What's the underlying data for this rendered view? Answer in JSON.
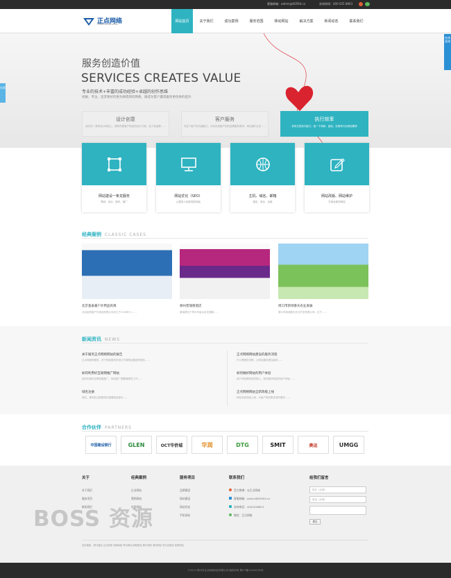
{
  "topbar": {
    "email": "客服邮箱：admin@00594.cn",
    "phone": "咨询热线：400 025 8803"
  },
  "logo": {
    "name": "正点网络",
    "sub": "ZHENGDIAN NETWORK"
  },
  "nav": [
    "网站首页",
    "关于我们",
    "成功案例",
    "服务范围",
    "移动网站",
    "解决方案",
    "新闻动态",
    "联系我们"
  ],
  "hero": {
    "title_cn": "服务创造价值",
    "title_en": "SERVICES CREATES VALUE",
    "sub": "专业的技术+丰富的成功经验+卓越的创作思维",
    "desc": "机敏、专注，追求更好的更为顾得到的网络，随成为客户赢得服务更优秀的提升",
    "tabs": [
      {
        "title": "设计创意",
        "desc": "我们在一类的设计网站上，拥有的是客户网站的设计方案，定义到品牌……"
      },
      {
        "title": "客户服务",
        "desc": "丰富了客户的沟通能力，分析实现客户的的品牌服务需求，网站通行业多……"
      },
      {
        "title": "执行效率",
        "desc": "来传达的执行能力，统一下来和，高效，实现有行业网站需求"
      }
    ]
  },
  "services": [
    {
      "icon": "crop-icon",
      "title": "网站建设一条龙服务",
      "desc": "策划、设计、制作、推广"
    },
    {
      "icon": "monitor-icon",
      "title": "网站优化（SEO）",
      "desc": "让更多人找到您的网站"
    },
    {
      "icon": "basketball-icon",
      "title": "主机、域名、邮箱",
      "desc": "稳定、低价、全能"
    },
    {
      "icon": "edit-icon",
      "title": "网站改版、网站维护",
      "desc": "打造全新的网站"
    }
  ],
  "cases": {
    "title": "经典案例",
    "en": "CLASSIC CASES",
    "items": [
      {
        "title": "北京金泰嘉户外用品有限",
        "desc": "北京金泰嘉户外用品有限公司成立于2008年十……"
      },
      {
        "title": "郑州普瑞德酒店",
        "desc": "普瑞德位于郑州市金水区花园路……"
      },
      {
        "title": "周口市新绿春天农业发展",
        "desc": "周口市新绿春天农业开发有限公司，位于……"
      }
    ]
  },
  "news": {
    "title": "新闻资讯",
    "en": "NEWS",
    "left": [
      {
        "title": "关于服务正点网络网站的报告",
        "desc": "正点网络的服务，关于网站服务的设计方案网站建设的报告……"
      },
      {
        "title": "如何利用好互联网推广网站",
        "desc": "如何利用好互联网做推广，网站推广需要做哪些工作……"
      },
      {
        "title": "域名注册",
        "desc": "域名，是域名注册服务的重要组成部分……"
      }
    ],
    "right": [
      {
        "title": "正点网络网站建设的服务流程",
        "desc": "什么是服务流程，让网站建设更加高效……"
      },
      {
        "title": "如何做好网站的用户体验",
        "desc": "用户体验是网站的核心，如何做好网站的用户体验……"
      },
      {
        "title": "正点网络网站全新改版上线",
        "desc": "网站全新改版上线，为客户提供更优质的服务……"
      }
    ]
  },
  "partners": {
    "title": "合作伙伴",
    "en": "PARTNERS",
    "logos": [
      "中国建设银行",
      "GLEN",
      "OCT华侨城",
      "华润",
      "DTG",
      "SMIT",
      "奥运",
      "UMGG"
    ]
  },
  "footer": {
    "cols": [
      {
        "title": "关于",
        "items": [
          "关于我们",
          "服务项目",
          "联系我们"
        ]
      },
      {
        "title": "经典案例",
        "items": [
          "企业网站",
          "营销网站",
          "外贸网站"
        ]
      },
      {
        "title": "服务项目",
        "items": [
          "品牌建设",
          "网站建设",
          "网站优化",
          "手机网站"
        ]
      }
    ],
    "contact": {
      "title": "联系我们",
      "items": [
        "官方微博：@正点网络",
        "客服邮箱：admin@00594.cn",
        "咨询电话：4000258803",
        "微信：正点网络"
      ]
    },
    "message": {
      "title": "给我们留言",
      "name_ph": "姓名（必填）",
      "phone_ph": "电话（必填）",
      "submit": "提交"
    },
    "links": "友情链接：周口建站 正点网络 河南网络 郑州网站 南阳网站 周口网络 漯河网站 驻马店网站 信阳网站",
    "copyright": "©2015 周口市正点网络科技有限公司 版权所有 豫ICP备15000000号"
  },
  "float_right": "在线咨询",
  "float_left": "分享",
  "watermark": "BOSS 资源"
}
